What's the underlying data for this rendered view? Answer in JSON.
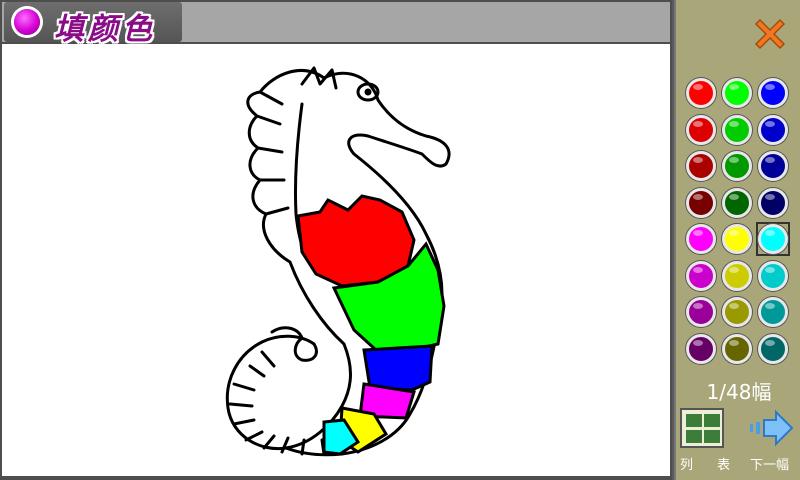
{
  "title": "填颜色",
  "page_counter": "1/48幅",
  "list_label": "列 表",
  "next_label": "下一幅",
  "colors": {
    "title_bar": "#a6a6a6",
    "title_text": "#8b0c88",
    "side_panel": "#a9a77a",
    "close_icon": "#f07820"
  },
  "palette": [
    [
      "#ff0000",
      "#00ff00",
      "#0000ff"
    ],
    [
      "#dd0000",
      "#00cc00",
      "#0000cc"
    ],
    [
      "#aa0000",
      "#009900",
      "#000099"
    ],
    [
      "#770000",
      "#006600",
      "#000066"
    ],
    [
      "#ff00ff",
      "#ffff00",
      "#00ffff"
    ],
    [
      "#cc00cc",
      "#cccc00",
      "#00cccc"
    ],
    [
      "#990099",
      "#999900",
      "#009999"
    ],
    [
      "#660066",
      "#666600",
      "#006666"
    ]
  ],
  "selected_color": "#00ffff",
  "seahorse_fills": {
    "neck": "#ff0000",
    "belly": "#00ff00",
    "band_blue": "#0000ff",
    "band_magenta": "#ff00ff",
    "band_yellow": "#ffff00",
    "band_cyan": "#00ffff"
  }
}
